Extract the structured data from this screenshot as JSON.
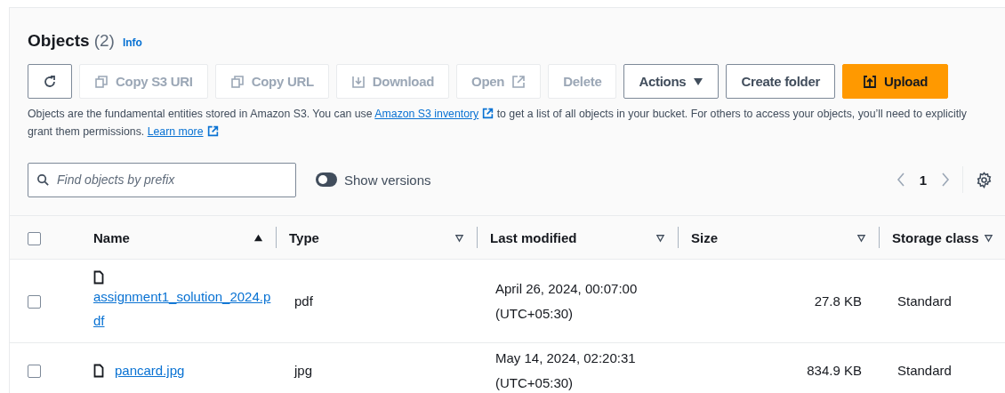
{
  "header": {
    "title": "Objects",
    "count": "(2)",
    "info": "Info"
  },
  "buttons": [
    {
      "kind": "refresh",
      "disabled": false
    },
    {
      "kind": "copy",
      "label": "Copy S3 URI",
      "disabled": true
    },
    {
      "kind": "copy",
      "label": "Copy URL",
      "disabled": true
    },
    {
      "kind": "download",
      "label": "Download",
      "disabled": true
    },
    {
      "kind": "external",
      "label": "Open",
      "disabled": true
    },
    {
      "kind": "plain",
      "label": "Delete",
      "disabled": true
    },
    {
      "kind": "dropdown",
      "label": "Actions",
      "disabled": false
    },
    {
      "kind": "plain",
      "label": "Create folder",
      "disabled": false
    },
    {
      "kind": "upload",
      "label": "Upload",
      "disabled": false
    }
  ],
  "description": [
    {
      "kind": "text",
      "text": "Objects are the fundamental entities stored in Amazon S3. You can use "
    },
    {
      "kind": "link",
      "text": "Amazon S3 inventory"
    },
    {
      "kind": "text",
      "text": " to get a list of all objects in your bucket. For others to access your objects, you’ll need to explicitly grant them permissions. "
    },
    {
      "kind": "link",
      "text": "Learn more"
    }
  ],
  "search": {
    "placeholder": "Find objects by prefix"
  },
  "show_versions": {
    "label": "Show versions",
    "on": false
  },
  "pagination": {
    "page": "1"
  },
  "select_all": {
    "checked": false
  },
  "columns": [
    {
      "label": "Name",
      "sorted": true
    },
    {
      "label": "Type",
      "sorted": false
    },
    {
      "label": "Last modified",
      "sorted": false
    },
    {
      "label": "Size",
      "sorted": false
    },
    {
      "label": "Storage class",
      "sorted": false
    }
  ],
  "rows": [
    {
      "checked": false,
      "name": "assignment1_solution_2024.pdf",
      "type": "pdf",
      "last_modified": "April 26, 2024, 00:07:00 (UTC+05:30)",
      "size": "27.8 KB",
      "storage_class": "Standard"
    },
    {
      "checked": false,
      "name": "pancard.jpg",
      "type": "jpg",
      "last_modified": "May 14, 2024, 02:20:31 (UTC+05:30)",
      "size": "834.9 KB",
      "storage_class": "Standard"
    }
  ]
}
